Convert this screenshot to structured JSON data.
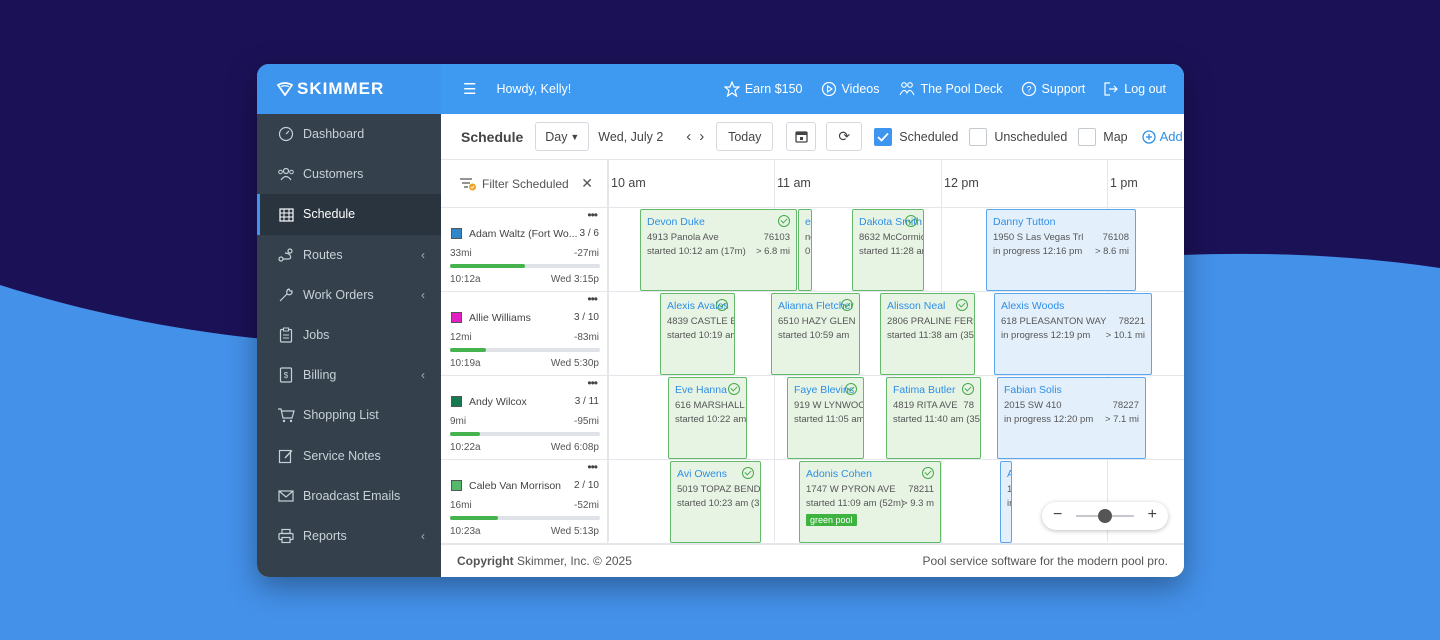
{
  "brand": "SKIMMER",
  "greeting": "Howdy, Kelly!",
  "top_links": [
    {
      "icon": "star-icon",
      "label": "Earn $150"
    },
    {
      "icon": "play-icon",
      "label": "Videos"
    },
    {
      "icon": "people-icon",
      "label": "The Pool Deck"
    },
    {
      "icon": "help-icon",
      "label": "Support"
    },
    {
      "icon": "logout-icon",
      "label": "Log out"
    }
  ],
  "nav": [
    {
      "label": "Dashboard",
      "icon": "dashboard-icon"
    },
    {
      "label": "Customers",
      "icon": "customers-icon"
    },
    {
      "label": "Schedule",
      "icon": "calendar-icon",
      "active": true
    },
    {
      "label": "Routes",
      "icon": "routes-icon",
      "chevron": true
    },
    {
      "label": "Work Orders",
      "icon": "wrench-icon",
      "chevron": true
    },
    {
      "label": "Jobs",
      "icon": "clipboard-icon"
    },
    {
      "label": "Billing",
      "icon": "billing-icon",
      "chevron": true
    },
    {
      "label": "Shopping List",
      "icon": "cart-icon"
    },
    {
      "label": "Service Notes",
      "icon": "note-icon"
    },
    {
      "label": "Broadcast Emails",
      "icon": "mail-icon"
    },
    {
      "label": "Reports",
      "icon": "printer-icon",
      "chevron": true
    }
  ],
  "toolbar": {
    "title": "Schedule",
    "view": "Day",
    "date": "Wed, July 2",
    "today": "Today",
    "scheduled": "Scheduled",
    "unscheduled": "Unscheduled",
    "map": "Map",
    "add": "Add"
  },
  "filter_label": "Filter Scheduled",
  "hours": [
    "10 am",
    "11 am",
    "12 pm",
    "1 pm"
  ],
  "techs": [
    {
      "name": "Adam Waltz (Fort Wo...",
      "count": "3 / 6",
      "color": "#2f86c8",
      "miles": "33mi",
      "delta": "-27mi",
      "progress": 0.5,
      "start": "10:12a",
      "end": "Wed 3:15p"
    },
    {
      "name": "Allie Williams",
      "count": "3 / 10",
      "color": "#e21fc3",
      "miles": "12mi",
      "delta": "-83mi",
      "progress": 0.24,
      "start": "10:19a",
      "end": "Wed 5:30p"
    },
    {
      "name": "Andy Wilcox",
      "count": "3 / 11",
      "color": "#157a4f",
      "miles": "9mi",
      "delta": "-95mi",
      "progress": 0.2,
      "start": "10:22a",
      "end": "Wed 6:08p"
    },
    {
      "name": "Caleb Van Morrison",
      "count": "2 / 10",
      "color": "#55b86b",
      "miles": "16mi",
      "delta": "-52mi",
      "progress": 0.32,
      "start": "10:23a",
      "end": "Wed 5:13p"
    }
  ],
  "jobs": [
    [
      {
        "name": "Devon Duke",
        "addr": "4913 Panola Ave",
        "zip": "76103",
        "status": "started 10:12 am (17m)",
        "dist": "> 6.8 mi",
        "state": "done"
      },
      {
        "name": "ens",
        "addr": "nde",
        "zip": "",
        "status": "0:5",
        "dist": "",
        "state": "done"
      },
      {
        "name": "Dakota Smith",
        "addr": "8632 McCormic",
        "zip": "",
        "status": "started 11:28 am",
        "dist": "",
        "state": "done"
      },
      {
        "name": "Danny Tutton",
        "addr": "1950 S Las Vegas Trl",
        "zip": "76108",
        "status": "in progress 12:16 pm",
        "dist": "> 8.6 mi",
        "state": "progress"
      }
    ],
    [
      {
        "name": "Alexis Avalos",
        "addr": "4839 CASTLE BO",
        "zip": "",
        "status": "started 10:19 am",
        "dist": "",
        "state": "done"
      },
      {
        "name": "Alianna Fletcher",
        "addr": "6510 HAZY GLEN",
        "zip": "",
        "status": "started 10:59 am",
        "dist": "",
        "state": "done"
      },
      {
        "name": "Alisson Neal",
        "addr": "2806 PRALINE FERRY",
        "zip": "",
        "status": "started 11:38 am (35",
        "dist": "",
        "state": "done"
      },
      {
        "name": "Alexis Woods",
        "addr": "618 PLEASANTON WAY",
        "zip": "78221",
        "status": "in progress 12:19 pm",
        "dist": "> 10.1 mi",
        "state": "progress"
      }
    ],
    [
      {
        "name": "Eve Hanna",
        "addr": "616 MARSHALL S",
        "zip": "",
        "status": "started 10:22 am",
        "dist": "",
        "state": "done"
      },
      {
        "name": "Faye Blevins",
        "addr": "919 W LYNWOO",
        "zip": "",
        "status": "started 11:05 am",
        "dist": "",
        "state": "done"
      },
      {
        "name": "Fatima Butler",
        "addr": "4819 RITA AVE",
        "zip": "78",
        "status": "started 11:40 am (35",
        "dist": "",
        "state": "done"
      },
      {
        "name": "Fabian Solis",
        "addr": "2015 SW 410",
        "zip": "78227",
        "status": "in progress 12:20 pm",
        "dist": "> 7.1 mi",
        "state": "progress"
      }
    ],
    [
      {
        "name": "Avi Owens",
        "addr": "5019 TOPAZ BEND",
        "zip": "",
        "status": "started 10:23 am (3",
        "dist": "",
        "state": "done"
      },
      {
        "name": "Adonis Cohen",
        "addr": "1747 W PYRON AVE",
        "zip": "78211",
        "status": "started 11:09 am (52m)",
        "dist": "> 9.3 m",
        "state": "done",
        "tag": "green pool"
      },
      {
        "name": "A",
        "addr": "1",
        "zip": "",
        "status": "in",
        "dist": "",
        "state": "progress"
      }
    ]
  ],
  "footer": {
    "copyright_strong": "Copyright",
    "copyright_rest": " Skimmer, Inc. © 2025",
    "tagline": "Pool service software for the modern pool pro."
  }
}
